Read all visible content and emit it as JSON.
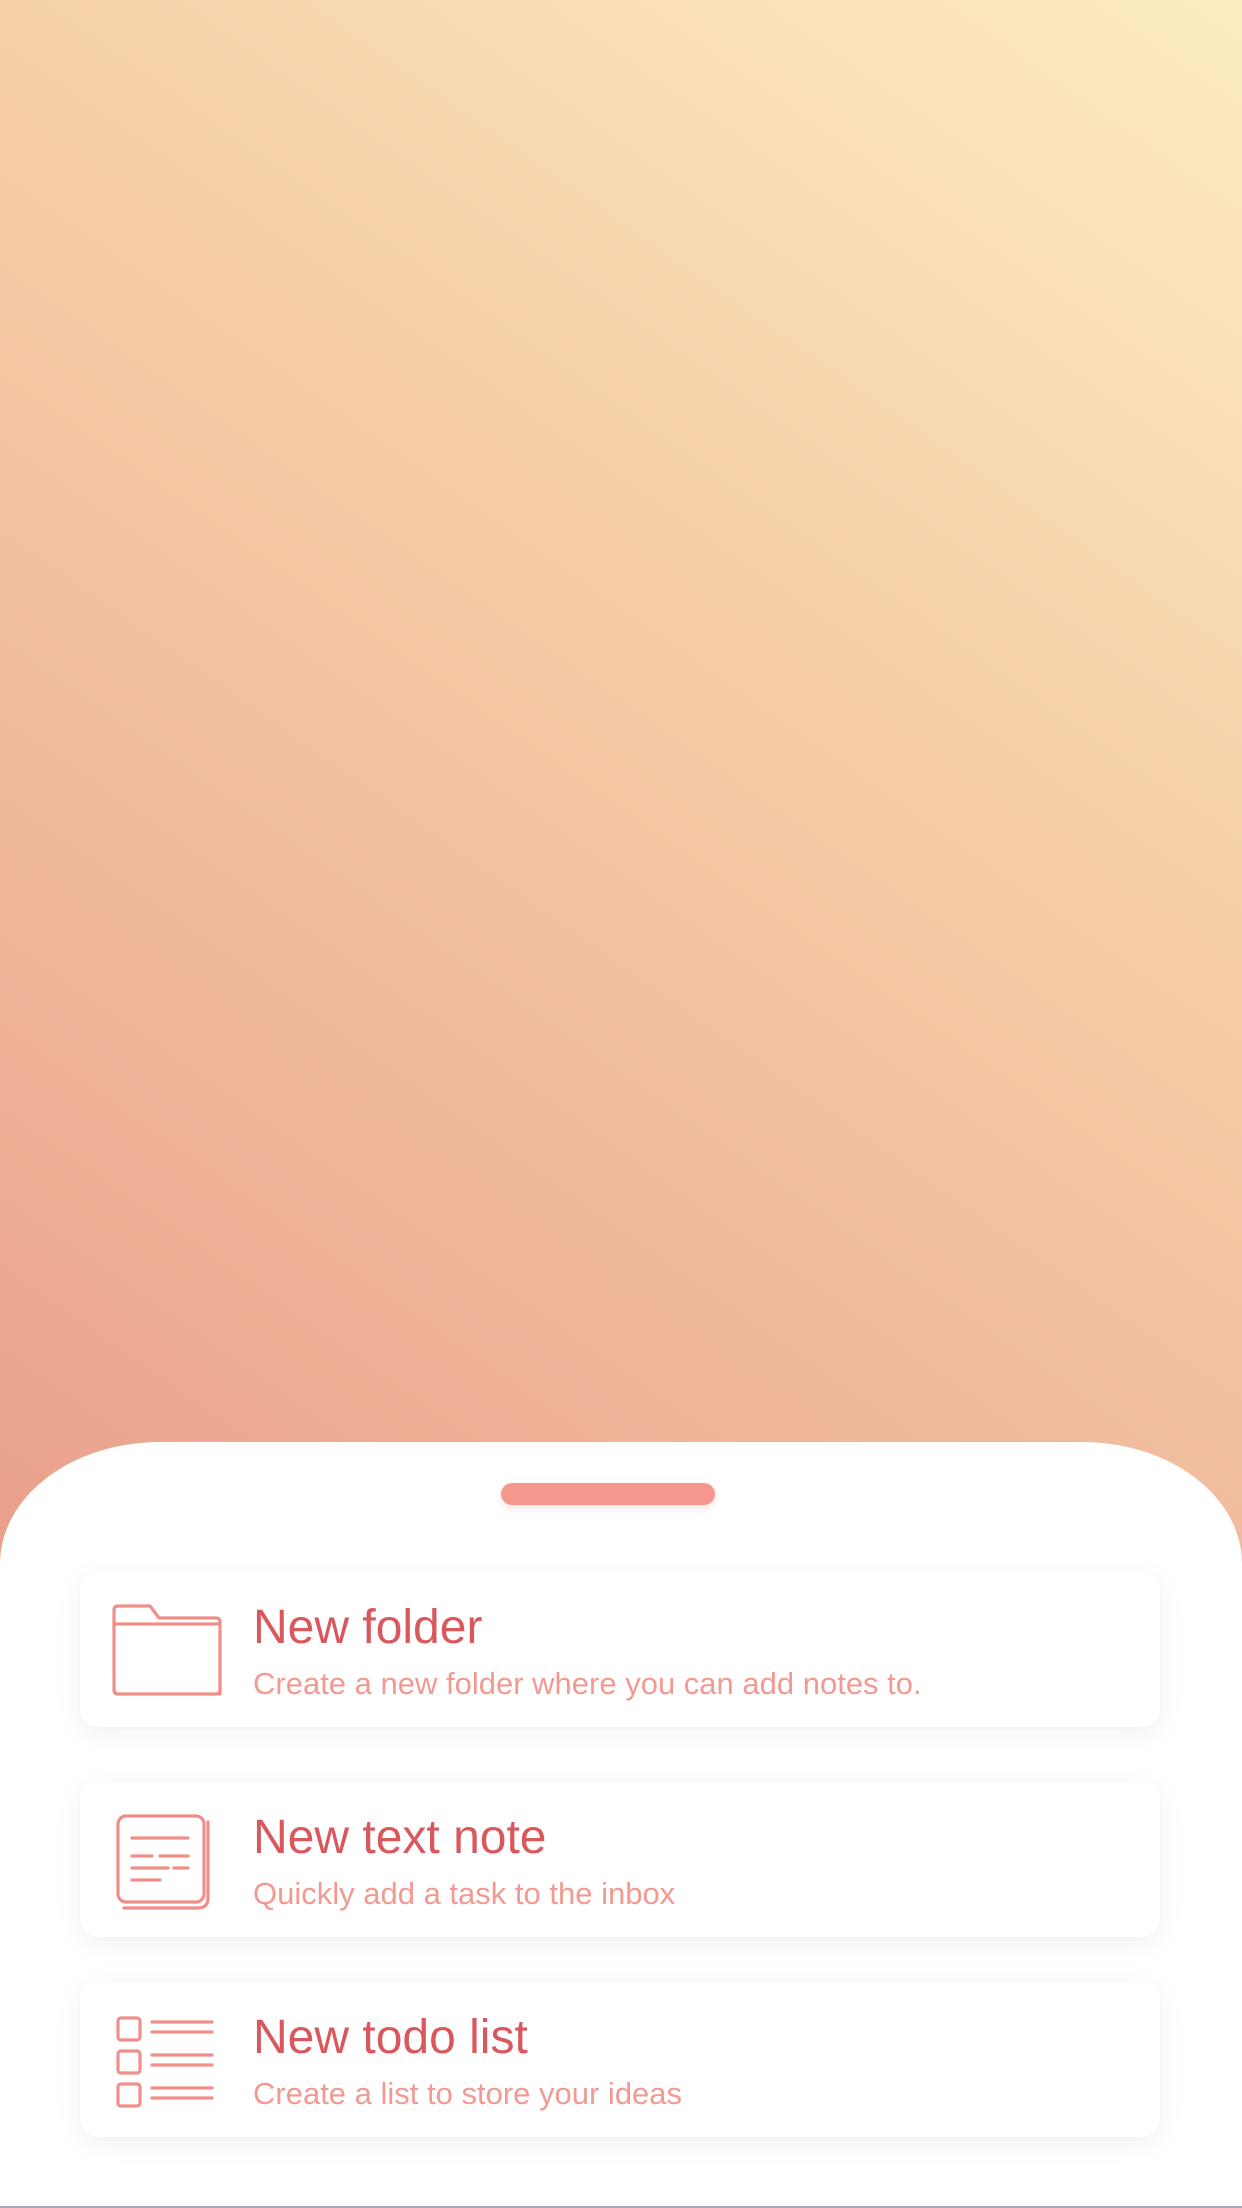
{
  "colors": {
    "title": "#d9585e",
    "subtitle": "#f29a92",
    "icon": "#ef8f8a",
    "handle": "#f6978e",
    "gradient_top_right": "#fdecc3",
    "gradient_bottom_left": "#e48a80"
  },
  "sheet": {
    "items": [
      {
        "icon": "folder-icon",
        "title": "New folder",
        "subtitle": "Create a new folder where you can add notes to."
      },
      {
        "icon": "text-note-icon",
        "title": "New text note",
        "subtitle": "Quickly add a task to the inbox"
      },
      {
        "icon": "todo-list-icon",
        "title": "New todo list",
        "subtitle": "Create a list to store your ideas"
      }
    ]
  }
}
